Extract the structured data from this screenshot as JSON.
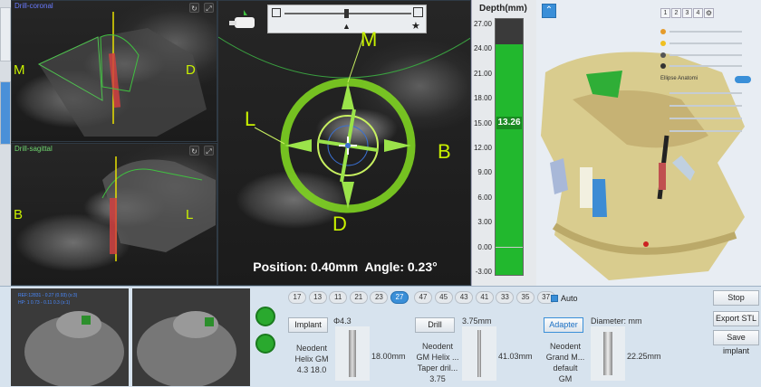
{
  "views": {
    "coronal": {
      "title": "Drill-coronal",
      "left": "M",
      "right": "D"
    },
    "sagittal": {
      "title": "Drill-sagittal",
      "left": "B",
      "right": "L"
    },
    "axial": {
      "labels": {
        "top": "M",
        "left": "L",
        "right": "B",
        "bottom": "D"
      },
      "status": "Position: 0.40mm  Angle: 0.23°"
    }
  },
  "depth": {
    "title": "Depth(mm)",
    "value": "13.26",
    "fill_fraction": 0.9,
    "ticks": [
      "27.00",
      "24.00",
      "21.00",
      "18.00",
      "15.00",
      "12.00",
      "9.00",
      "6.00",
      "3.00",
      "0.00",
      "-3.00"
    ]
  },
  "view3d": {
    "pages": [
      "1",
      "2",
      "3",
      "4"
    ],
    "layer_label": "Ellipse Anatomi"
  },
  "cameras": {
    "cam1_lines": [
      "REF:12831 - 0.27 (0.93) (s:3)",
      "HP: 1 0.73 - 0.11 0.3 (s:1)"
    ]
  },
  "teeth": {
    "upper": [
      "17",
      "13",
      "11",
      "21",
      "23",
      "27"
    ],
    "lower": [
      "47",
      "45",
      "43",
      "41",
      "33",
      "35",
      "37"
    ],
    "auto_label": "Auto"
  },
  "implant": {
    "button": "Implant",
    "diameter": "Φ4.3",
    "length": "18.00mm",
    "desc": [
      "Neodent",
      "Helix GM",
      "4.3 18.0"
    ]
  },
  "drill": {
    "button": "Drill",
    "top": "3.75mm",
    "length": "41.03mm",
    "desc": [
      "Neodent",
      "GM Helix ...",
      "Taper dril...",
      "3.75"
    ]
  },
  "adapter": {
    "button": "Adapter",
    "diameter_label": "Diameter: mm",
    "length": "22.25mm",
    "desc": [
      "Neodent",
      "Grand M...",
      "default",
      "GM"
    ]
  },
  "side_buttons": {
    "stop": "Stop",
    "export": "Export STL",
    "save": "Save implant"
  },
  "colors": {
    "accent": "#3a8fd8",
    "depth_green": "#22b82e",
    "target_green": "#7ed321",
    "label_yellow": "#c8f000"
  }
}
